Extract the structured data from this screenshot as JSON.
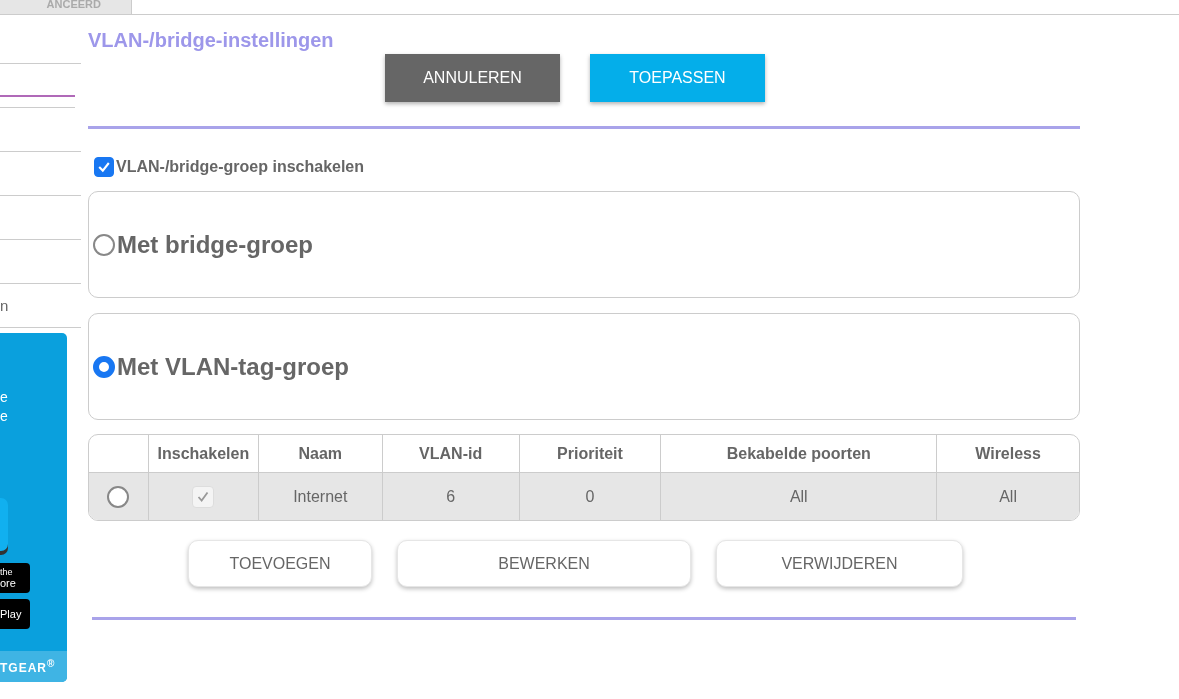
{
  "top_tab": {
    "label": "ANCEERD"
  },
  "sidebar": {
    "items": [
      {
        "selected": false
      },
      {
        "selected": true
      },
      {
        "selected": false
      },
      {
        "selected": false
      },
      {
        "selected": false
      },
      {
        "selected": false
      },
      {
        "label": "n",
        "selected": false
      }
    ]
  },
  "promo": {
    "lines": [
      "e",
      "e"
    ],
    "badges": [
      {
        "small": "the",
        "label": "ore"
      },
      {
        "label": "Play"
      }
    ],
    "brand": "TGEAR$^{®}$"
  },
  "title": "VLAN-/bridge-instellingen",
  "actions": [
    "ANNULEREN",
    "TOEPASSEN"
  ],
  "enable_group": {
    "label": "VLAN-/bridge-groep inschakelen",
    "checked": true
  },
  "modes": [
    {
      "label": "Met bridge-groep",
      "selected": false
    },
    {
      "label": "Met VLAN-tag-groep",
      "selected": true
    }
  ],
  "table": {
    "columns": [
      "",
      "Inschakelen",
      "Naam",
      "VLAN-id",
      "Prioriteit",
      "Bekabelde poorten",
      "Wireless"
    ],
    "rows": [
      {
        "selected": false,
        "enabled": true,
        "cells": [
          "",
          "",
          "Internet",
          "6",
          "0",
          "All",
          "All"
        ]
      }
    ]
  },
  "row_buttons": [
    "TOEVOEGEN",
    "BEWERKEN",
    "VERWIJDEREN"
  ]
}
